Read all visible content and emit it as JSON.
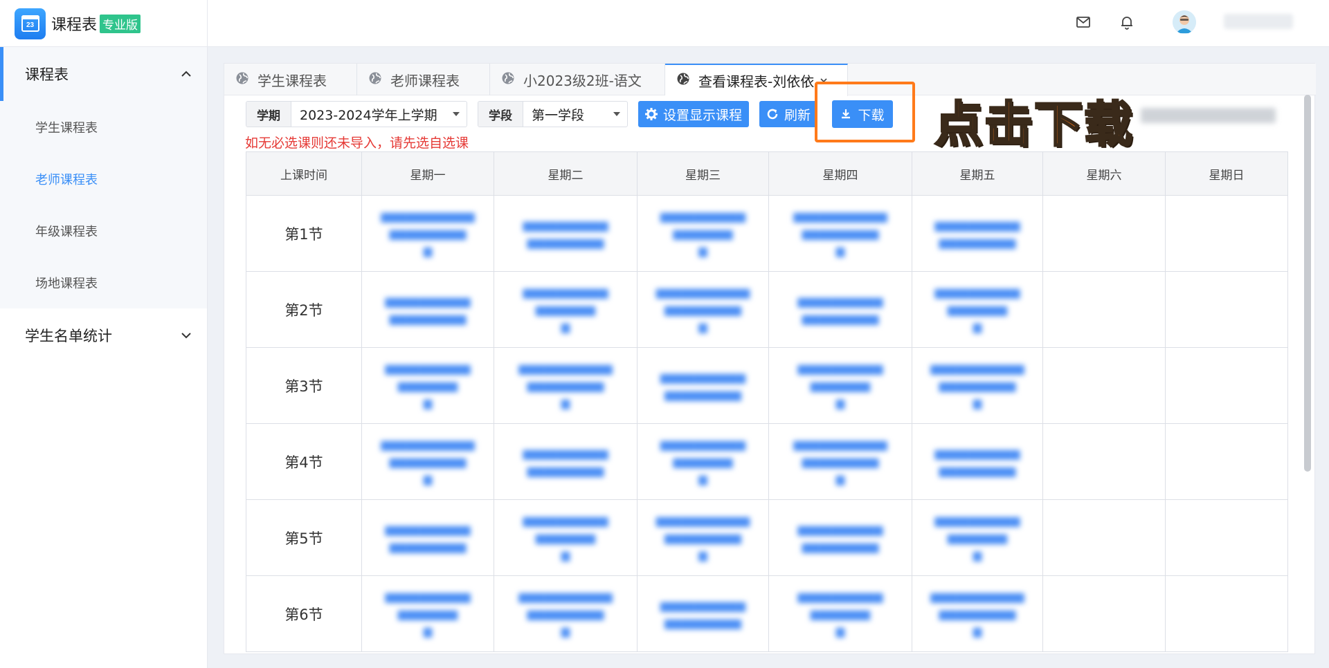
{
  "header": {
    "app_title": "课程表",
    "edition_badge": "专业版",
    "logo_day": "23"
  },
  "sidebar": {
    "groups": [
      {
        "label": "课程表",
        "expanded": true,
        "items": [
          {
            "label": "学生课程表"
          },
          {
            "label": "老师课程表",
            "active": true
          },
          {
            "label": "年级课程表"
          },
          {
            "label": "场地课程表"
          }
        ]
      },
      {
        "label": "学生名单统计",
        "expanded": false
      }
    ]
  },
  "tabs": [
    {
      "label": "学生课程表"
    },
    {
      "label": "老师课程表"
    },
    {
      "label": "小2023级2班-语文"
    },
    {
      "label": "查看课程表-刘依依",
      "active": true
    }
  ],
  "toolbar": {
    "term_label": "学期",
    "term_value": "2023-2024学年上学期",
    "stage_label": "学段",
    "stage_value": "第一学段",
    "settings_button": "设置显示课程",
    "refresh_button": "刷新",
    "download_button": "下载"
  },
  "annotation": "点击下载",
  "warning": "如无必选课则还未导入，请先选自选课",
  "timetable": {
    "headers": [
      "上课时间",
      "星期一",
      "星期二",
      "星期三",
      "星期四",
      "星期五",
      "星期六",
      "星期日"
    ],
    "periods": [
      "第1节",
      "第2节",
      "第3节",
      "第4节",
      "第5节",
      "第6节"
    ]
  },
  "colors": {
    "accent": "#3a8ff7",
    "highlight": "#ff7a1a",
    "warning": "#e53935",
    "badge": "#2fc48c"
  }
}
